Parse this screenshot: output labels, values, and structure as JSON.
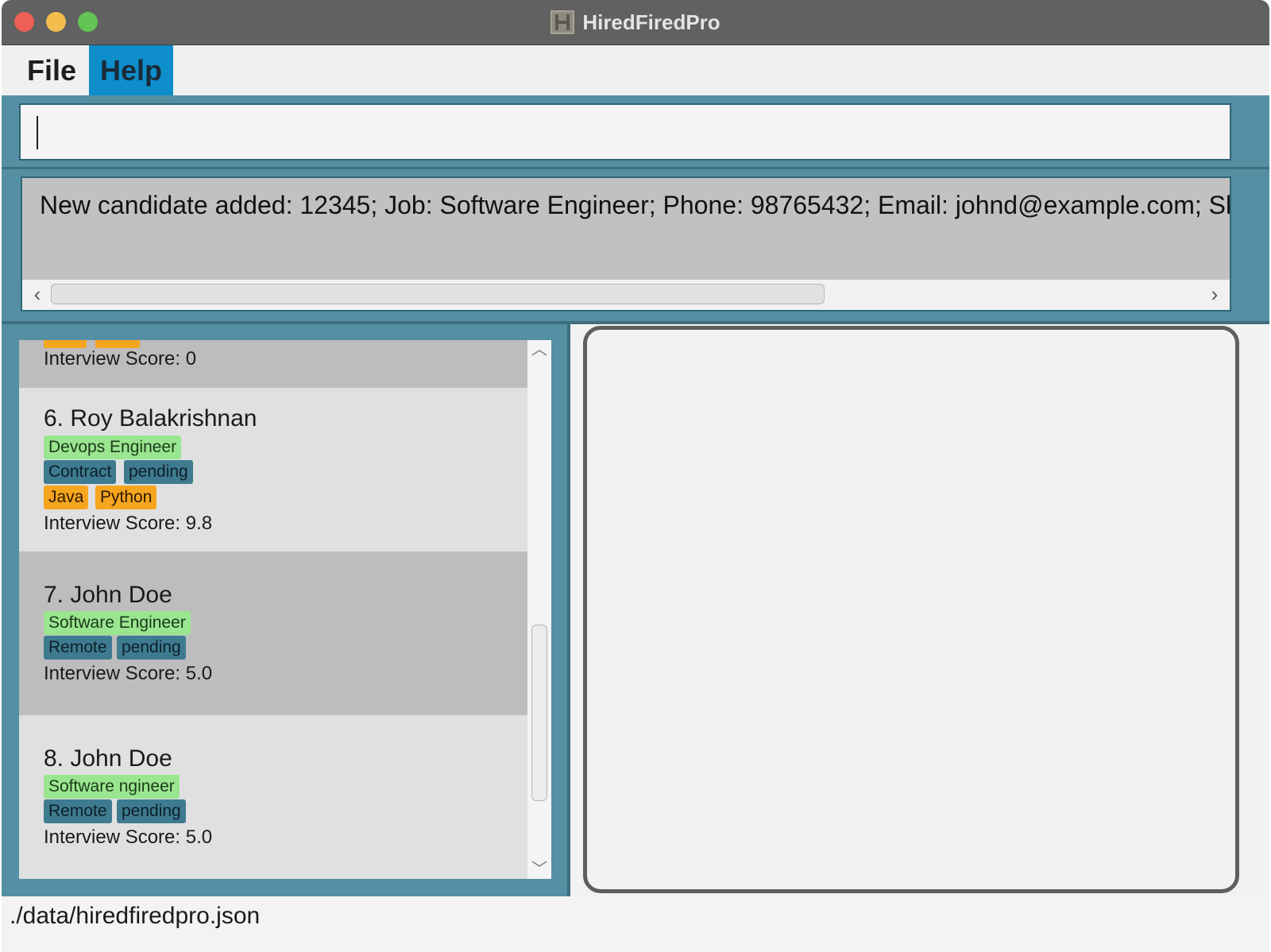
{
  "window": {
    "title": "HiredFiredPro"
  },
  "menu": {
    "file": "File",
    "help": "Help"
  },
  "command": {
    "value": ""
  },
  "result": {
    "text": "New candidate added: 12345; Job: Software Engineer; Phone: 98765432; Email: johnd@example.com; Sk"
  },
  "candidates": [
    {
      "name": "",
      "job": "",
      "statuses": [],
      "skills": [],
      "score": "Interview Score: 0"
    },
    {
      "name": "6. Roy Balakrishnan",
      "job": "Devops Engineer",
      "statuses": [
        "Contract",
        "pending"
      ],
      "skills": [
        "Java",
        "Python"
      ],
      "score": "Interview Score: 9.8"
    },
    {
      "name": "7. John Doe",
      "job": "Software Engineer",
      "statuses": [
        "Remote",
        "pending"
      ],
      "skills": [],
      "score": "Interview Score: 5.0"
    },
    {
      "name": "8. John Doe",
      "job": "Software ngineer",
      "statuses": [
        "Remote",
        "pending"
      ],
      "skills": [],
      "score": "Interview Score: 5.0"
    }
  ],
  "status_bar": {
    "path": "./data/hiredfiredpro.json"
  },
  "colors": {
    "accent": "#558fa3",
    "job_tag": "#9ae58f",
    "status_tag": "#3e7b91",
    "skill_tag": "#f6a51f",
    "menu_active": "#0e8fcc"
  },
  "icons": {
    "app": "app-logo-icon",
    "scroll_left": "chevron-left-icon",
    "scroll_right": "chevron-right-icon",
    "scroll_up": "chevron-up-icon",
    "scroll_down": "chevron-down-icon"
  }
}
